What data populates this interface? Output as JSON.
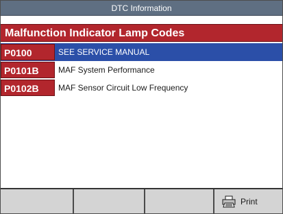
{
  "window": {
    "title": "DTC Information"
  },
  "header": {
    "title": "Malfunction Indicator Lamp Codes"
  },
  "codes": [
    {
      "code": "P0100",
      "description": "SEE SERVICE MANUAL",
      "selected": true
    },
    {
      "code": "P0101B",
      "description": "MAF System Performance",
      "selected": false
    },
    {
      "code": "P0102B",
      "description": "MAF Sensor Circuit Low Frequency",
      "selected": false
    }
  ],
  "footer": {
    "keys": [
      {
        "label": ""
      },
      {
        "label": ""
      },
      {
        "label": ""
      },
      {
        "label": "Print",
        "icon": "printer-icon"
      }
    ]
  },
  "colors": {
    "title_bar": "#5f6f82",
    "header_red": "#b2262d",
    "selection_blue": "#2b4fa8"
  }
}
